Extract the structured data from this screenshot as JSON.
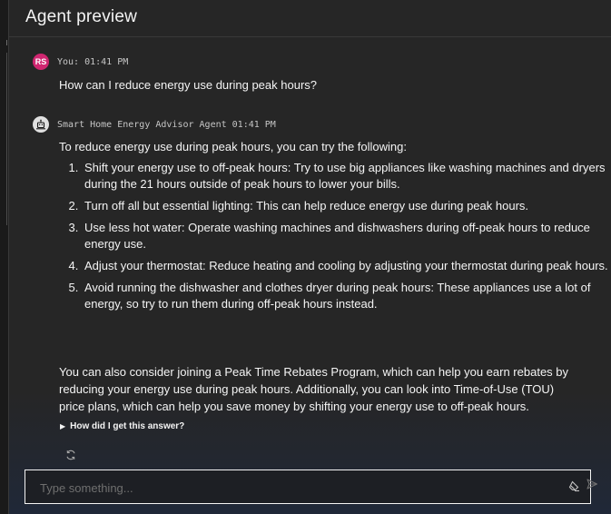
{
  "header": {
    "title": "Agent preview"
  },
  "user_message": {
    "avatar_initials": "RS",
    "meta": "You: 01:41 PM",
    "text": "How can I reduce energy use during peak hours?"
  },
  "agent_message": {
    "meta": "Smart Home Energy Advisor Agent 01:41 PM",
    "intro": "To reduce energy use during peak hours, you can try the following:",
    "steps": [
      "Shift your energy use to off-peak hours: Try to use big appliances like washing machines and dryers during the 21 hours outside of peak hours to lower your bills.",
      "Turn off all but essential lighting: This can help reduce energy use during peak hours.",
      "Use less hot water: Operate washing machines and dishwashers during off-peak hours to reduce energy use.",
      "Adjust your thermostat: Reduce heating and cooling by adjusting your thermostat during peak hours.",
      "Avoid running the dishwasher and clothes dryer during peak hours: These appliances use a lot of energy, so try to run them during off-peak hours instead."
    ],
    "closing": "You can also consider joining a Peak Time Rebates Program, which can help you earn rebates by reducing your energy use during peak hours. Additionally, you can look into Time-of-Use (TOU) price plans, which can help you save money by shifting your energy use to off-peak hours.",
    "disclosure_label": "How did I get this answer?"
  },
  "composer": {
    "placeholder": "Type something..."
  },
  "icons": {
    "user_avatar": "avatar",
    "agent_avatar": "robot-icon",
    "disclosure": "caret-right-icon",
    "regenerate": "regenerate-icon",
    "clear": "eraser-icon",
    "send": "send-icon"
  },
  "colors": {
    "accent_avatar": "#d02670",
    "panel_bg": "#262626",
    "text": "#f4f4f4"
  }
}
